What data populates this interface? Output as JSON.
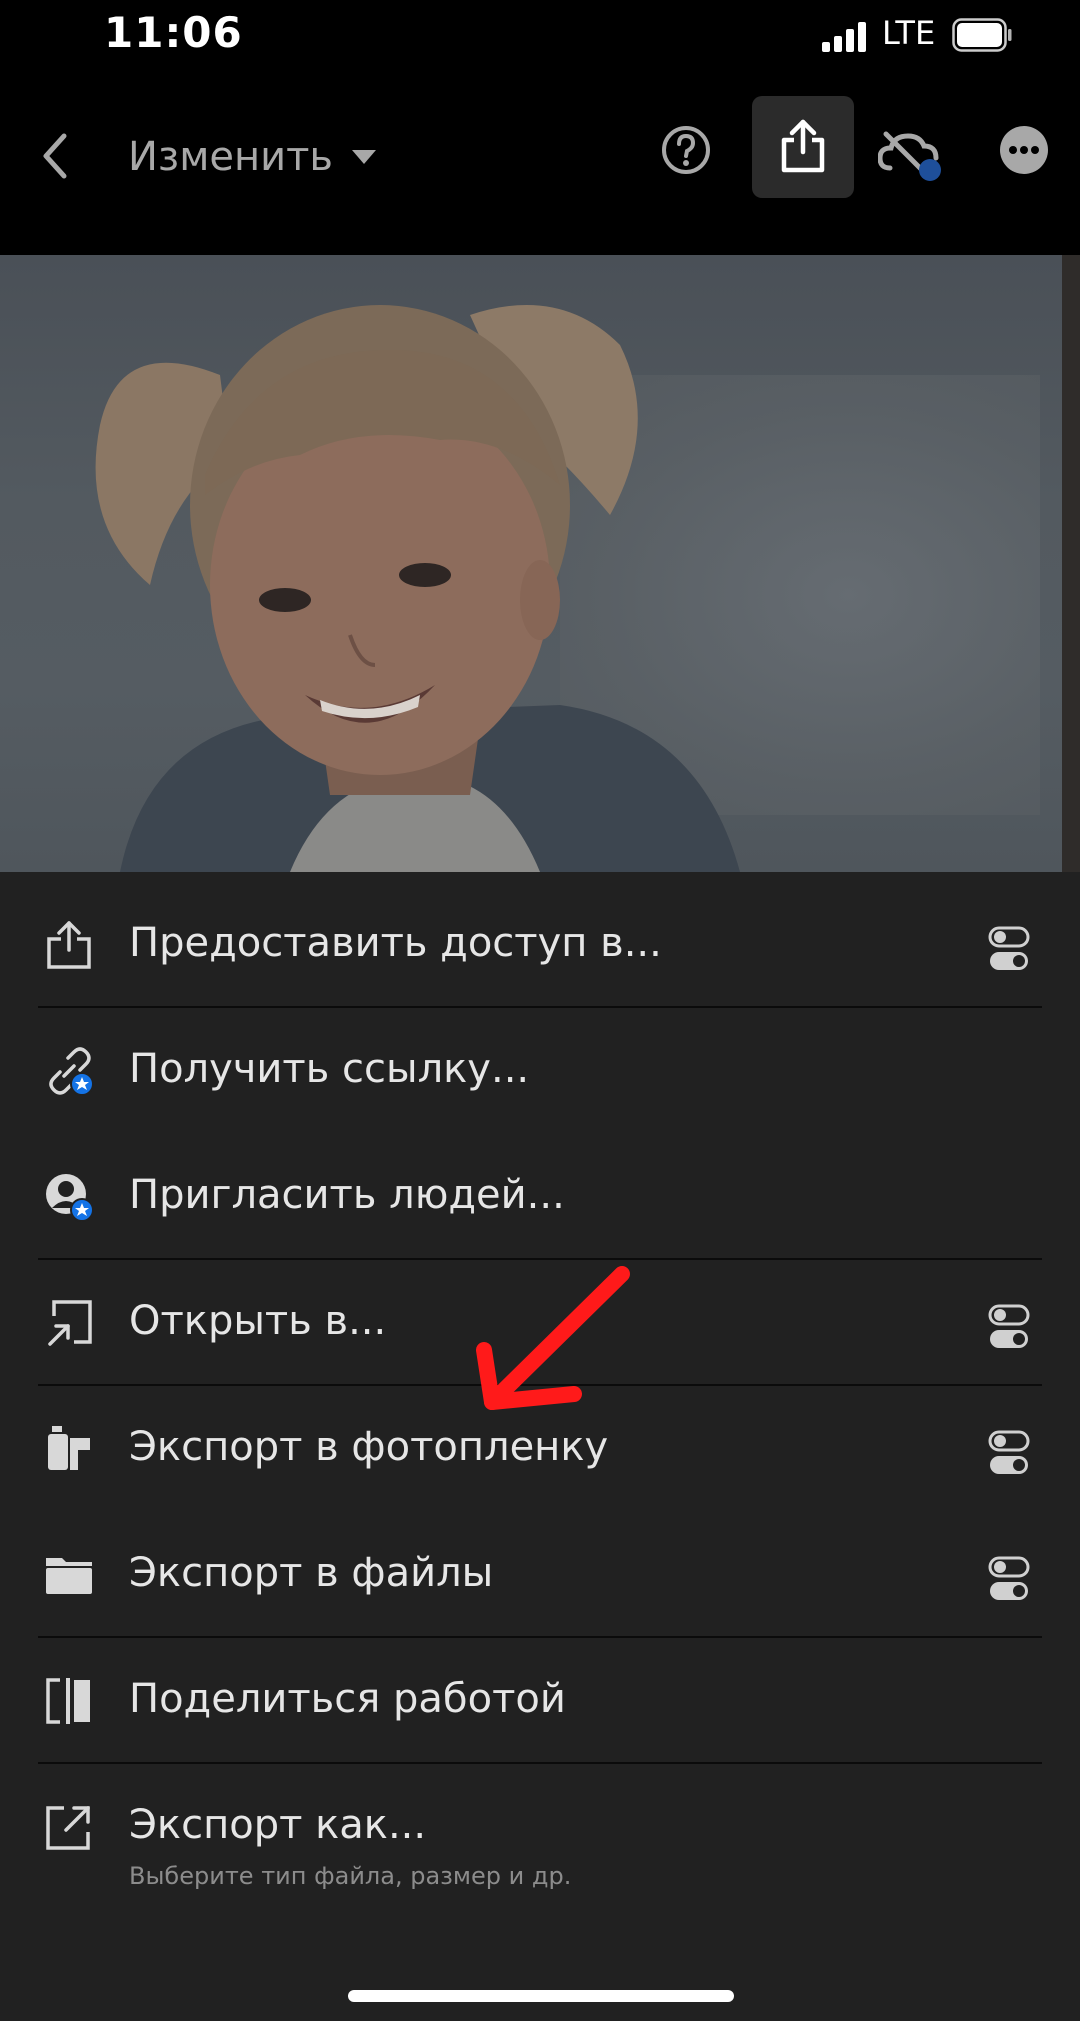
{
  "status_bar": {
    "time": "11:06",
    "network": "LTE"
  },
  "header": {
    "title": "Изменить"
  },
  "icons": {
    "back": "chevron-left-icon",
    "help": "question-circle-icon",
    "share": "share-upload-icon",
    "cloud": "cloud-off-icon",
    "more": "more-dots-icon"
  },
  "menu": {
    "items": [
      {
        "label": "Предоставить доступ в...",
        "icon": "share-icon",
        "has_toggle": true
      },
      {
        "label": "Получить ссылку...",
        "icon": "link-premium-icon",
        "has_toggle": false
      },
      {
        "label": "Пригласить людей...",
        "icon": "invite-person-premium-icon",
        "has_toggle": false
      },
      {
        "label": "Открыть в...",
        "icon": "open-in-icon",
        "has_toggle": true
      },
      {
        "label": "Экспорт в фотопленку",
        "icon": "camera-roll-icon",
        "has_toggle": true
      },
      {
        "label": "Экспорт в файлы",
        "icon": "folder-icon",
        "has_toggle": true
      },
      {
        "label": "Поделиться работой",
        "icon": "share-edit-icon",
        "has_toggle": false
      },
      {
        "label": "Экспорт как...",
        "sublabel": "Выберите тип файла, размер и др.",
        "icon": "export-as-icon",
        "has_toggle": false
      }
    ]
  },
  "colors": {
    "background": "#212121",
    "topbar": "#000000",
    "accent_blue": "#1473e6",
    "annotation_arrow": "#ff0000"
  }
}
